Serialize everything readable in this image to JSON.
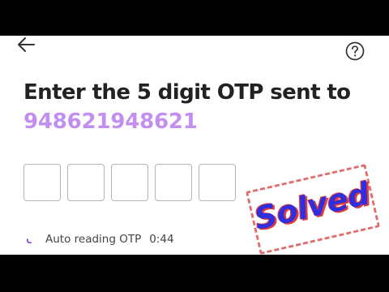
{
  "header": {
    "back_icon": "arrow-left-icon",
    "help_icon": "question-circle-icon"
  },
  "main": {
    "title_line1": "Enter the 5 digit OTP sent to",
    "phone_number": "948621948621",
    "otp_digit_count": 5,
    "otp_values": [
      "",
      "",
      "",
      "",
      ""
    ]
  },
  "status": {
    "auto_reading_label": "Auto reading OTP",
    "timer": "0:44"
  },
  "overlay": {
    "stamp_text": "Solved"
  },
  "colors": {
    "accent": "#c28ff0",
    "title": "#222222",
    "box_border": "#b5b5b5",
    "stamp_text": "#2f2fe0",
    "stamp_shadow": "#e23b3b",
    "stamp_border": "#e26b6b"
  }
}
